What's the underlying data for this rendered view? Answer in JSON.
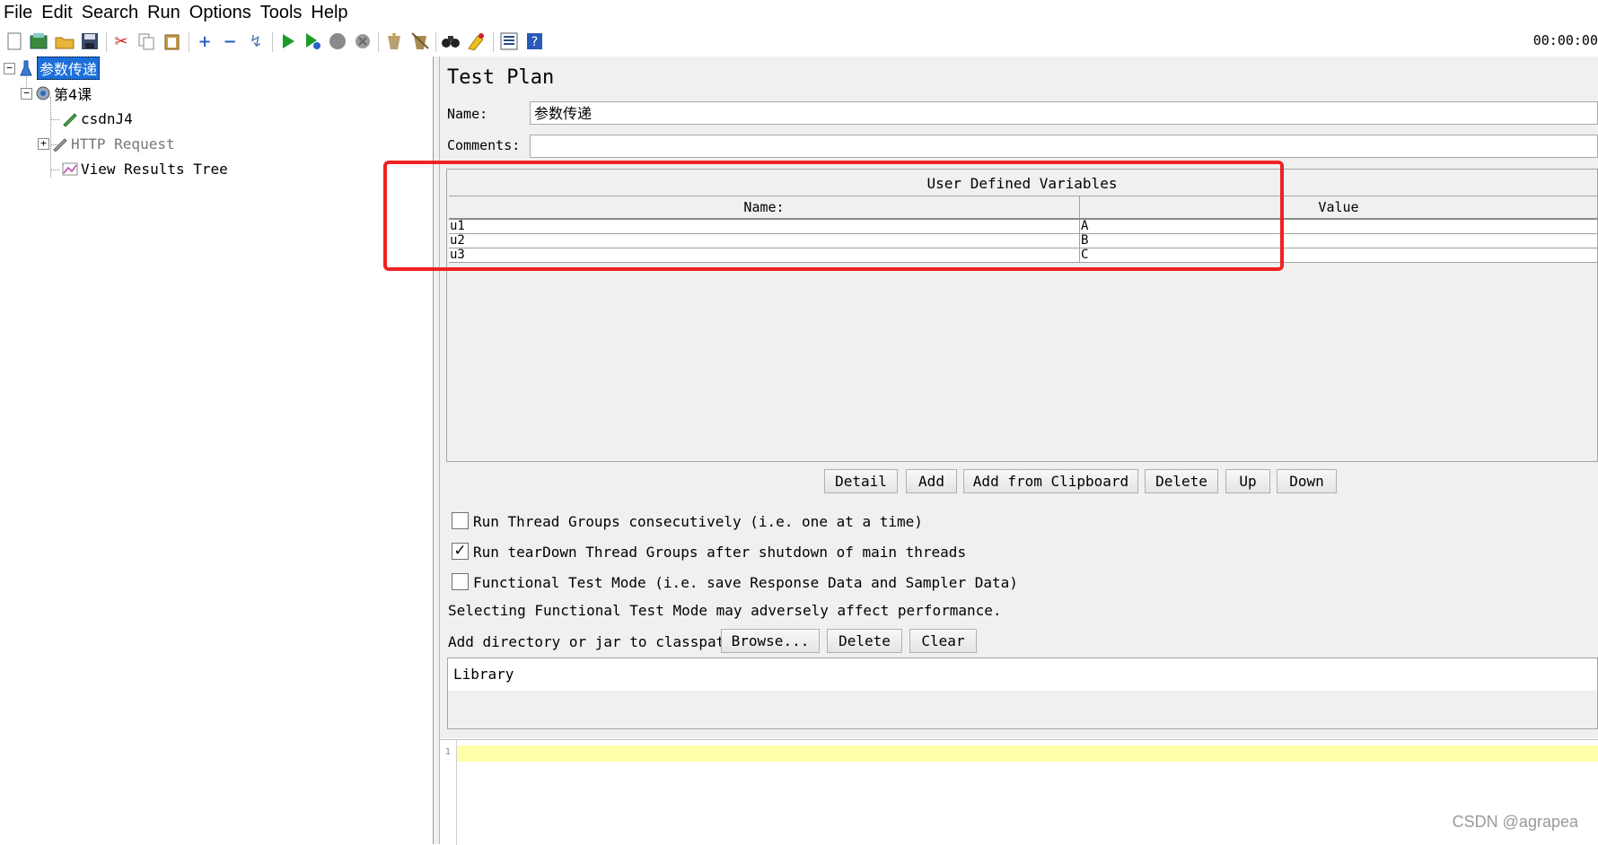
{
  "menu": [
    "File",
    "Edit",
    "Search",
    "Run",
    "Options",
    "Tools",
    "Help"
  ],
  "toolbar": {
    "timer": "00:00:00",
    "icons": [
      "new-icon",
      "templates-icon",
      "open-icon",
      "save-icon",
      "cut-icon",
      "copy-icon",
      "paste-icon",
      "expand-icon",
      "collapse-icon",
      "toggle-icon",
      "start-icon",
      "start-no-pause-icon",
      "stop-icon",
      "shutdown-icon",
      "clear-icon",
      "clear-all-icon",
      "search-icon",
      "reset-search-icon",
      "function-helper-icon",
      "help-icon"
    ]
  },
  "tree": {
    "root": "参数传递",
    "thread_group": "第4课",
    "items": [
      "csdnJ4",
      "HTTP Request",
      "View Results Tree"
    ]
  },
  "main": {
    "title": "Test Plan",
    "name_label": "Name:",
    "name_value": "参数传递",
    "comments_label": "Comments:",
    "comments_value": "",
    "udv": {
      "title": "User Defined Variables",
      "col_name": "Name:",
      "col_value": "Value",
      "rows": [
        {
          "name": "u1",
          "value": "A"
        },
        {
          "name": "u2",
          "value": "B"
        },
        {
          "name": "u3",
          "value": "C"
        }
      ]
    },
    "table_buttons": [
      "Detail",
      "Add",
      "Add from Clipboard",
      "Delete",
      "Up",
      "Down"
    ],
    "options": [
      {
        "label": "Run Thread Groups consecutively (i.e. one at a time)",
        "checked": false
      },
      {
        "label": "Run tearDown Thread Groups after shutdown of main threads",
        "checked": true
      },
      {
        "label": "Functional Test Mode (i.e. save Response Data and Sampler Data)",
        "checked": false
      }
    ],
    "functional_note": "Selecting Functional Test Mode may adversely affect performance.",
    "classpath_label": "Add directory or jar to classpath",
    "classpath_buttons": [
      "Browse...",
      "Delete",
      "Clear"
    ],
    "library_header": "Library"
  },
  "editor": {
    "line_number": "1"
  },
  "watermark": "CSDN @agrapea"
}
